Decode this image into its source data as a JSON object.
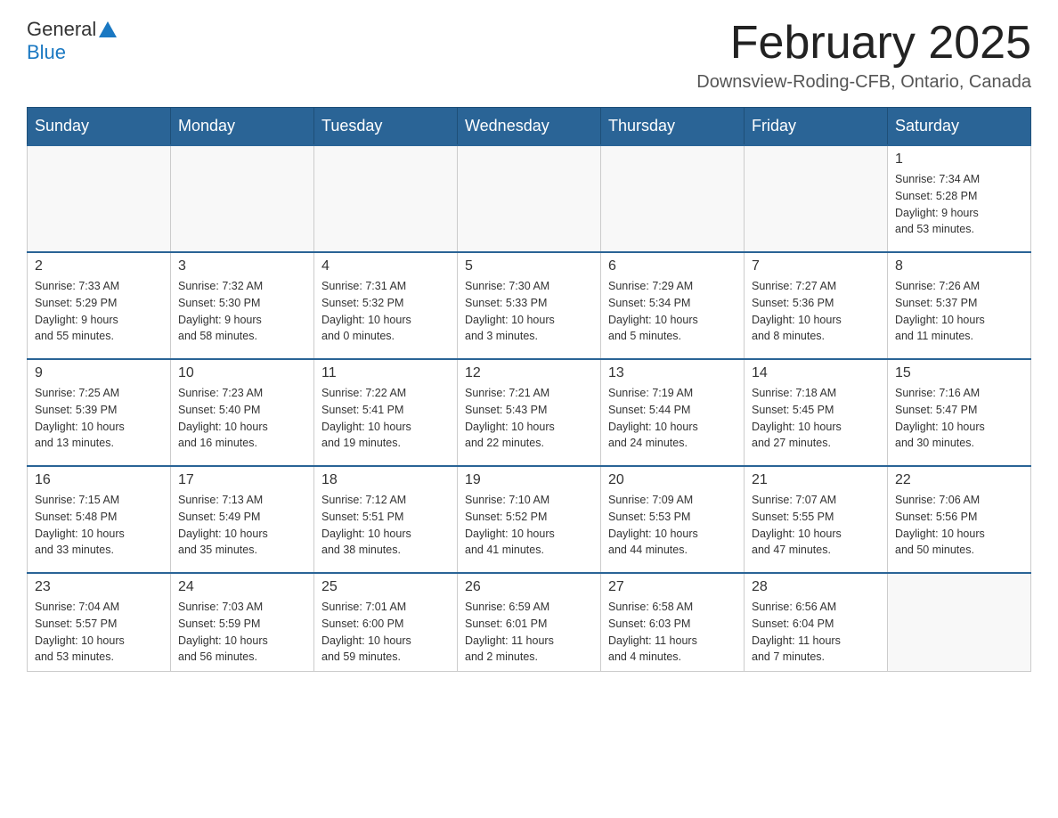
{
  "header": {
    "logo": {
      "general": "General",
      "blue": "Blue"
    },
    "title": "February 2025",
    "location": "Downsview-Roding-CFB, Ontario, Canada"
  },
  "days_of_week": [
    "Sunday",
    "Monday",
    "Tuesday",
    "Wednesday",
    "Thursday",
    "Friday",
    "Saturday"
  ],
  "weeks": [
    [
      {
        "day": "",
        "info": ""
      },
      {
        "day": "",
        "info": ""
      },
      {
        "day": "",
        "info": ""
      },
      {
        "day": "",
        "info": ""
      },
      {
        "day": "",
        "info": ""
      },
      {
        "day": "",
        "info": ""
      },
      {
        "day": "1",
        "info": "Sunrise: 7:34 AM\nSunset: 5:28 PM\nDaylight: 9 hours\nand 53 minutes."
      }
    ],
    [
      {
        "day": "2",
        "info": "Sunrise: 7:33 AM\nSunset: 5:29 PM\nDaylight: 9 hours\nand 55 minutes."
      },
      {
        "day": "3",
        "info": "Sunrise: 7:32 AM\nSunset: 5:30 PM\nDaylight: 9 hours\nand 58 minutes."
      },
      {
        "day": "4",
        "info": "Sunrise: 7:31 AM\nSunset: 5:32 PM\nDaylight: 10 hours\nand 0 minutes."
      },
      {
        "day": "5",
        "info": "Sunrise: 7:30 AM\nSunset: 5:33 PM\nDaylight: 10 hours\nand 3 minutes."
      },
      {
        "day": "6",
        "info": "Sunrise: 7:29 AM\nSunset: 5:34 PM\nDaylight: 10 hours\nand 5 minutes."
      },
      {
        "day": "7",
        "info": "Sunrise: 7:27 AM\nSunset: 5:36 PM\nDaylight: 10 hours\nand 8 minutes."
      },
      {
        "day": "8",
        "info": "Sunrise: 7:26 AM\nSunset: 5:37 PM\nDaylight: 10 hours\nand 11 minutes."
      }
    ],
    [
      {
        "day": "9",
        "info": "Sunrise: 7:25 AM\nSunset: 5:39 PM\nDaylight: 10 hours\nand 13 minutes."
      },
      {
        "day": "10",
        "info": "Sunrise: 7:23 AM\nSunset: 5:40 PM\nDaylight: 10 hours\nand 16 minutes."
      },
      {
        "day": "11",
        "info": "Sunrise: 7:22 AM\nSunset: 5:41 PM\nDaylight: 10 hours\nand 19 minutes."
      },
      {
        "day": "12",
        "info": "Sunrise: 7:21 AM\nSunset: 5:43 PM\nDaylight: 10 hours\nand 22 minutes."
      },
      {
        "day": "13",
        "info": "Sunrise: 7:19 AM\nSunset: 5:44 PM\nDaylight: 10 hours\nand 24 minutes."
      },
      {
        "day": "14",
        "info": "Sunrise: 7:18 AM\nSunset: 5:45 PM\nDaylight: 10 hours\nand 27 minutes."
      },
      {
        "day": "15",
        "info": "Sunrise: 7:16 AM\nSunset: 5:47 PM\nDaylight: 10 hours\nand 30 minutes."
      }
    ],
    [
      {
        "day": "16",
        "info": "Sunrise: 7:15 AM\nSunset: 5:48 PM\nDaylight: 10 hours\nand 33 minutes."
      },
      {
        "day": "17",
        "info": "Sunrise: 7:13 AM\nSunset: 5:49 PM\nDaylight: 10 hours\nand 35 minutes."
      },
      {
        "day": "18",
        "info": "Sunrise: 7:12 AM\nSunset: 5:51 PM\nDaylight: 10 hours\nand 38 minutes."
      },
      {
        "day": "19",
        "info": "Sunrise: 7:10 AM\nSunset: 5:52 PM\nDaylight: 10 hours\nand 41 minutes."
      },
      {
        "day": "20",
        "info": "Sunrise: 7:09 AM\nSunset: 5:53 PM\nDaylight: 10 hours\nand 44 minutes."
      },
      {
        "day": "21",
        "info": "Sunrise: 7:07 AM\nSunset: 5:55 PM\nDaylight: 10 hours\nand 47 minutes."
      },
      {
        "day": "22",
        "info": "Sunrise: 7:06 AM\nSunset: 5:56 PM\nDaylight: 10 hours\nand 50 minutes."
      }
    ],
    [
      {
        "day": "23",
        "info": "Sunrise: 7:04 AM\nSunset: 5:57 PM\nDaylight: 10 hours\nand 53 minutes."
      },
      {
        "day": "24",
        "info": "Sunrise: 7:03 AM\nSunset: 5:59 PM\nDaylight: 10 hours\nand 56 minutes."
      },
      {
        "day": "25",
        "info": "Sunrise: 7:01 AM\nSunset: 6:00 PM\nDaylight: 10 hours\nand 59 minutes."
      },
      {
        "day": "26",
        "info": "Sunrise: 6:59 AM\nSunset: 6:01 PM\nDaylight: 11 hours\nand 2 minutes."
      },
      {
        "day": "27",
        "info": "Sunrise: 6:58 AM\nSunset: 6:03 PM\nDaylight: 11 hours\nand 4 minutes."
      },
      {
        "day": "28",
        "info": "Sunrise: 6:56 AM\nSunset: 6:04 PM\nDaylight: 11 hours\nand 7 minutes."
      },
      {
        "day": "",
        "info": ""
      }
    ]
  ]
}
